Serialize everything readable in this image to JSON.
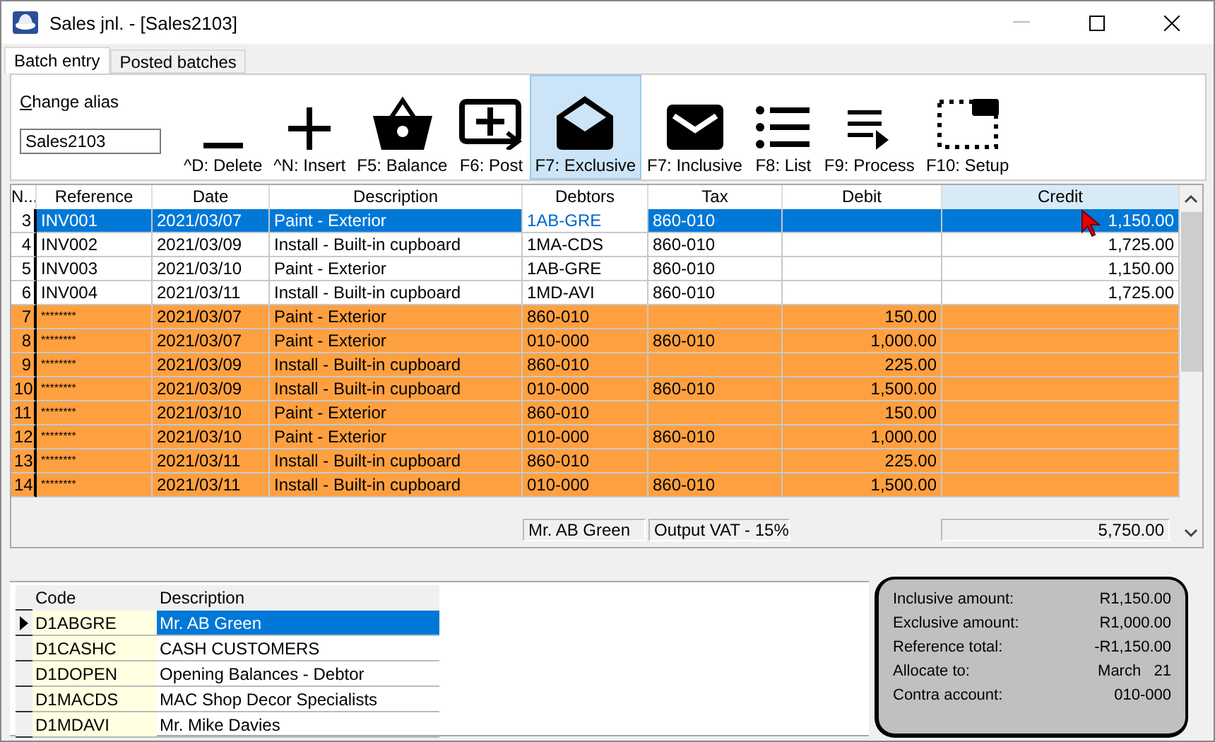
{
  "window": {
    "title": "Sales jnl. - [Sales2103]"
  },
  "tabs": [
    {
      "label": "Batch entry",
      "selected": true
    },
    {
      "label": "Posted batches",
      "selected": false
    }
  ],
  "alias": {
    "label": "Change alias",
    "value": "Sales2103"
  },
  "toolbar": [
    {
      "label": "^D: Delete",
      "kind": "minus",
      "selected": false
    },
    {
      "label": "^N: Insert",
      "kind": "plus",
      "selected": false
    },
    {
      "label": "F5: Balance",
      "kind": "basket",
      "selected": false
    },
    {
      "label": "F6: Post",
      "kind": "monitor",
      "selected": false
    },
    {
      "label": "F7: Exclusive",
      "kind": "envelope-open",
      "selected": true
    },
    {
      "label": "F7: Inclusive",
      "kind": "envelope",
      "selected": false
    },
    {
      "label": "F8: List",
      "kind": "list",
      "selected": false
    },
    {
      "label": "F9: Process",
      "kind": "queue",
      "selected": false
    },
    {
      "label": "F10: Setup",
      "kind": "setup",
      "selected": false
    }
  ],
  "table": {
    "columns": [
      {
        "label": "N...",
        "selected": false,
        "focused": false
      },
      {
        "label": "Reference",
        "selected": false,
        "focused": false
      },
      {
        "label": "Date",
        "selected": false,
        "focused": false
      },
      {
        "label": "Description",
        "selected": false,
        "focused": false
      },
      {
        "label": "Debtors",
        "selected": false,
        "focused": true
      },
      {
        "label": "Tax",
        "selected": false,
        "focused": false
      },
      {
        "label": "Debit",
        "selected": false,
        "focused": false
      },
      {
        "label": "Credit",
        "selected": true,
        "focused": false
      }
    ],
    "rows": [
      {
        "kind": "invoice",
        "selected": true,
        "cells": [
          "3",
          "INV001",
          "2021/03/07",
          "Paint - Exterior",
          "1AB-GRE",
          "860-010",
          "",
          "1,150.00"
        ]
      },
      {
        "kind": "invoice",
        "selected": false,
        "cells": [
          "4",
          "INV002",
          "2021/03/09",
          "Install - Built-in cupboard",
          "1MA-CDS",
          "860-010",
          "",
          "1,725.00"
        ]
      },
      {
        "kind": "invoice",
        "selected": false,
        "cells": [
          "5",
          "INV003",
          "2021/03/10",
          "Paint - Exterior",
          "1AB-GRE",
          "860-010",
          "",
          "1,150.00"
        ]
      },
      {
        "kind": "invoice",
        "selected": false,
        "cells": [
          "6",
          "INV004",
          "2021/03/11",
          "Install - Built-in cupboard",
          "1MD-AVI",
          "860-010",
          "",
          "1,725.00"
        ]
      },
      {
        "kind": "contra",
        "selected": false,
        "cells": [
          "7",
          "********",
          "2021/03/07",
          "Paint - Exterior",
          "860-010",
          "",
          "150.00",
          ""
        ]
      },
      {
        "kind": "contra",
        "selected": false,
        "cells": [
          "8",
          "********",
          "2021/03/07",
          "Paint - Exterior",
          "010-000",
          "860-010",
          "1,000.00",
          ""
        ]
      },
      {
        "kind": "contra",
        "selected": false,
        "cells": [
          "9",
          "********",
          "2021/03/09",
          "Install - Built-in cupboard",
          "860-010",
          "",
          "225.00",
          ""
        ]
      },
      {
        "kind": "contra",
        "selected": false,
        "cells": [
          "10",
          "********",
          "2021/03/09",
          "Install - Built-in cupboard",
          "010-000",
          "860-010",
          "1,500.00",
          ""
        ]
      },
      {
        "kind": "contra",
        "selected": false,
        "cells": [
          "11",
          "********",
          "2021/03/10",
          "Paint - Exterior",
          "860-010",
          "",
          "150.00",
          ""
        ]
      },
      {
        "kind": "contra",
        "selected": false,
        "cells": [
          "12",
          "********",
          "2021/03/10",
          "Paint - Exterior",
          "010-000",
          "860-010",
          "1,000.00",
          ""
        ]
      },
      {
        "kind": "contra",
        "selected": false,
        "cells": [
          "13",
          "********",
          "2021/03/11",
          "Install - Built-in cupboard",
          "860-010",
          "",
          "225.00",
          ""
        ]
      },
      {
        "kind": "contra",
        "selected": false,
        "cells": [
          "14",
          "********",
          "2021/03/11",
          "Install - Built-in cupboard",
          "010-000",
          "860-010",
          "1,500.00",
          ""
        ]
      }
    ],
    "summary": {
      "debtor": "Mr. AB Green",
      "tax": "Output VAT - 15%",
      "credit_total": "5,750.00"
    }
  },
  "lookup": {
    "columns": [
      "Code",
      "Description"
    ],
    "rows": [
      {
        "code": "D1ABGRE",
        "description": "Mr. AB Green",
        "selected": true
      },
      {
        "code": "D1CASHC",
        "description": "CASH CUSTOMERS",
        "selected": false
      },
      {
        "code": "D1DOPEN",
        "description": "Opening Balances - Debtor",
        "selected": false
      },
      {
        "code": "D1MACDS",
        "description": "MAC Shop Decor Specialists",
        "selected": false
      },
      {
        "code": "D1MDAVI",
        "description": "Mr. Mike Davies",
        "selected": false
      }
    ]
  },
  "info": [
    {
      "label": "Inclusive amount:",
      "value": "R1,150.00"
    },
    {
      "label": "Exclusive amount:",
      "value": "R1,000.00"
    },
    {
      "label": "Reference total:",
      "value": "-R1,150.00"
    },
    {
      "label": "Allocate to:",
      "value": "March   21"
    },
    {
      "label": "Contra account:",
      "value": "010-000"
    }
  ]
}
